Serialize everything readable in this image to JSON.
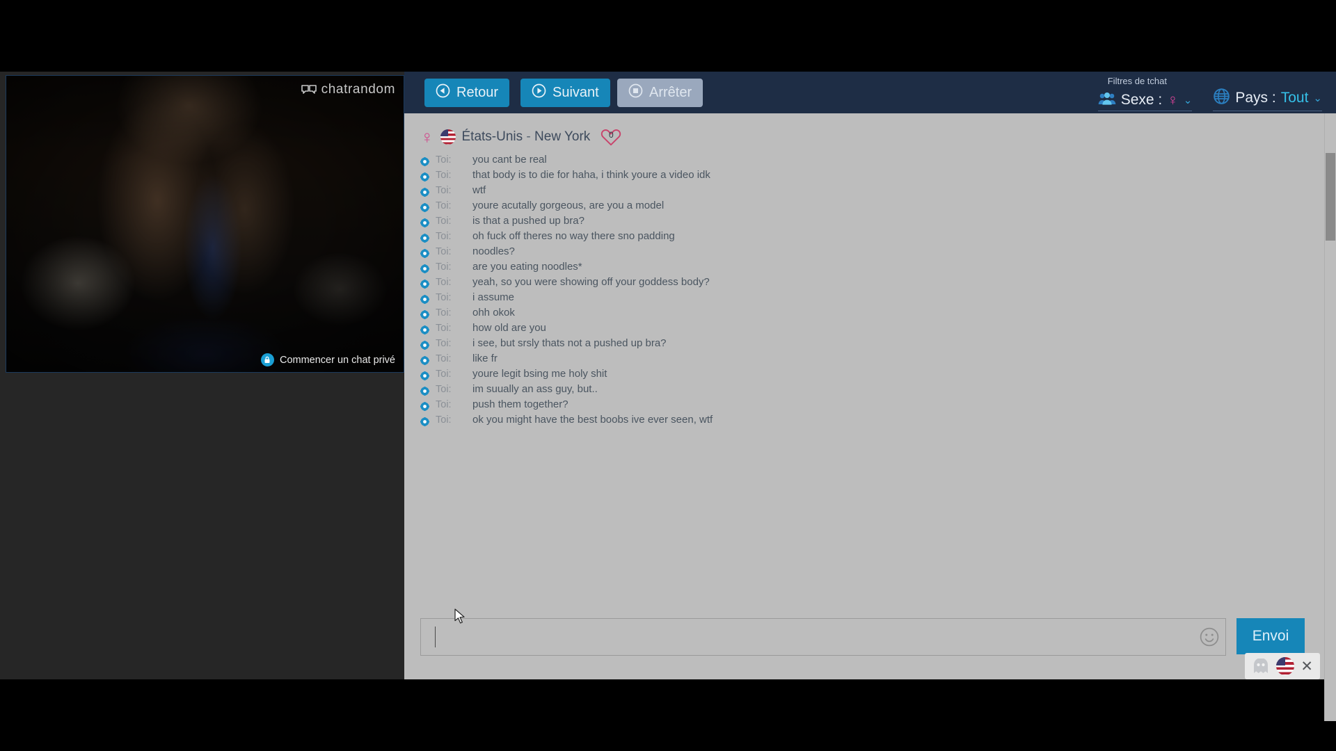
{
  "brand": {
    "logo_text": "chatrandom",
    "logo_icon": "double-speech-bubble-icon"
  },
  "video": {
    "private_chat_label": "Commencer un chat privé",
    "private_chat_icon": "lock-icon"
  },
  "toolbar": {
    "back_label": "Retour",
    "back_icon": "previous-arrow-icon",
    "next_label": "Suivant",
    "next_icon": "play-arrow-icon",
    "stop_label": "Arrêter",
    "stop_icon": "stop-square-icon",
    "stop_disabled": true
  },
  "filters": {
    "title": "Filtres de tchat",
    "gender": {
      "icon": "people-group-icon",
      "label": "Sexe :",
      "value": "♀",
      "caret_icon": "chevron-down-icon"
    },
    "country": {
      "icon": "globe-icon",
      "label": "Pays :",
      "value": "Tout",
      "caret_icon": "chevron-down-icon"
    }
  },
  "partner": {
    "gender_icon": "female-symbol-icon",
    "flag_icon": "us-flag-icon",
    "country": "États-Unis",
    "separator": "-",
    "region": "New York",
    "like_icon": "heart-outline-icon",
    "like_count": "0"
  },
  "chat": {
    "self_label": "Toi:",
    "bullet_icon": "gear-bullet-icon",
    "messages": [
      "you cant be  real",
      "that body is to die for haha, i think youre a video idk",
      "wtf",
      "youre acutally gorgeous, are you a model",
      "is that a pushed up bra?",
      "oh fuck off theres no way there sno padding",
      "noodles?",
      "are you eating noodles*",
      "yeah, so you were showing off your goddess body?",
      "i assume",
      "ohh okok",
      "how old are you",
      "i see, but srsly thats not a pushed up bra?",
      "like fr",
      "youre legit bsing me holy shit",
      "im suually an ass guy, but..",
      "push them together?",
      "ok you might have the best boobs ive ever seen, wtf"
    ]
  },
  "composer": {
    "input_value": "",
    "input_placeholder": "",
    "emoji_icon": "smiley-face-icon",
    "send_label": "Envoi"
  },
  "lang_widget": {
    "ghost_icon": "ghost-avatar-icon",
    "flag_icon": "us-flag-icon",
    "close_icon": "close-x-icon",
    "close_label": "✕"
  },
  "colors": {
    "accent_blue": "#1686b8",
    "topbar_navy": "#1e2d45",
    "panel_gray": "#bdbdbd",
    "pink": "#e0449a",
    "cyan": "#35c0e8",
    "heart_red": "#c8436b"
  }
}
